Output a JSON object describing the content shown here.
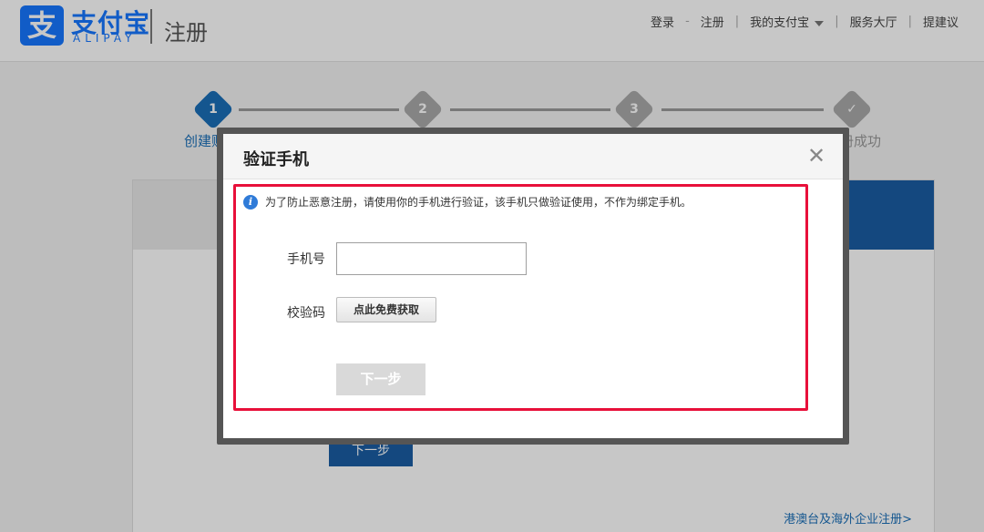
{
  "header": {
    "logo_glyph": "支",
    "logo_cn": "支付宝",
    "logo_en": "ALIPAY",
    "page_title": "注册",
    "nav": {
      "login": "登录",
      "dash": "-",
      "register": "注册",
      "my_alipay": "我的支付宝",
      "service_hall": "服务大厅",
      "suggest": "提建议"
    }
  },
  "steps": [
    {
      "num": "1",
      "label": "创建账户"
    },
    {
      "num": "2",
      "label": ""
    },
    {
      "num": "3",
      "label": ""
    },
    {
      "num": "✓",
      "label": "注册成功"
    }
  ],
  "panel": {
    "next_label": "下一步",
    "overseas_link": "港澳台及海外企业注册>"
  },
  "dialog": {
    "title": "验证手机",
    "close": "✕",
    "info_icon": "i",
    "info_text": "为了防止恶意注册，请使用你的手机进行验证，该手机只做验证使用，不作为绑定手机。",
    "phone_label": "手机号",
    "phone_value": "",
    "code_label": "校验码",
    "get_code_label": "点此免费获取",
    "next_label": "下一步"
  },
  "colors": {
    "brand": "#1677ff",
    "highlight": "#e8103a",
    "step_active": "#1a6fb8"
  }
}
